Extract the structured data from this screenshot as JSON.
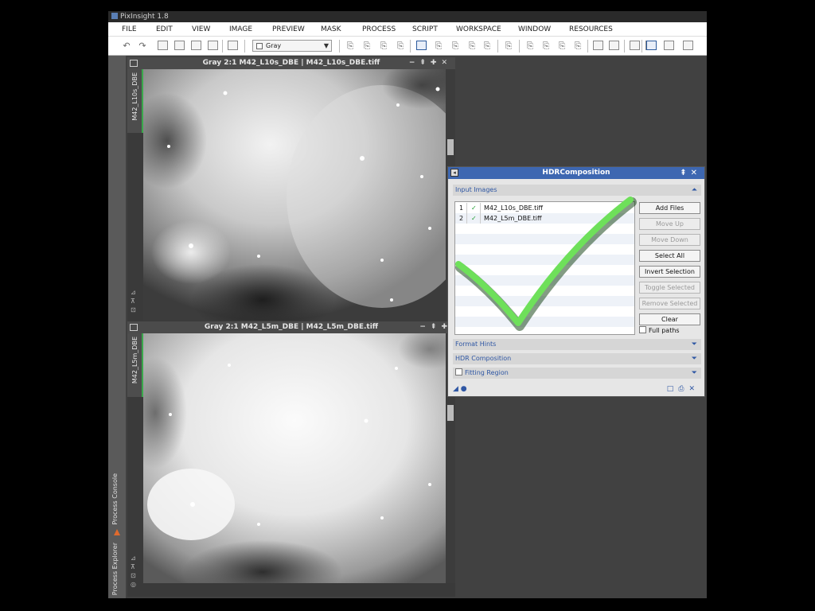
{
  "app": {
    "title": "PixInsight 1.8"
  },
  "menu": [
    "FILE",
    "EDIT",
    "VIEW",
    "IMAGE",
    "PREVIEW",
    "MASK",
    "PROCESS",
    "SCRIPT",
    "WORKSPACE",
    "WINDOW",
    "RESOURCES"
  ],
  "toolbar": {
    "colorspace_select": "Gray"
  },
  "dock": {
    "tab_process_console": "Process Console",
    "tab_process_explorer": "Process Explorer"
  },
  "windows": [
    {
      "title": "Gray 2:1 M42_L10s_DBE | M42_L10s_DBE.tiff",
      "tab_label": "M42_L10s_DBE"
    },
    {
      "title": "Gray 2:1 M42_L5m_DBE | M42_L5m_DBE.tiff",
      "tab_label": "M42_L5m_DBE"
    }
  ],
  "hdr_dialog": {
    "title": "HDRComposition",
    "sections": {
      "input_images": "Input Images",
      "format_hints": "Format Hints",
      "hdr_composition": "HDR Composition",
      "fitting_region": "Fitting Region"
    },
    "files": [
      {
        "index": "1",
        "checked": "✓",
        "name": "M42_L10s_DBE.tiff"
      },
      {
        "index": "2",
        "checked": "✓",
        "name": "M42_L5m_DBE.tiff"
      }
    ],
    "buttons": {
      "add_files": "Add Files",
      "move_up": "Move Up",
      "move_down": "Move Down",
      "select_all": "Select All",
      "invert_selection": "Invert Selection",
      "toggle_selected": "Toggle Selected",
      "remove_selected": "Remove Selected",
      "clear": "Clear"
    },
    "full_paths_label": "Full paths"
  },
  "colors": {
    "accent": "#3d67b1",
    "check_green": "#39a84b",
    "workspace": "#414141"
  }
}
